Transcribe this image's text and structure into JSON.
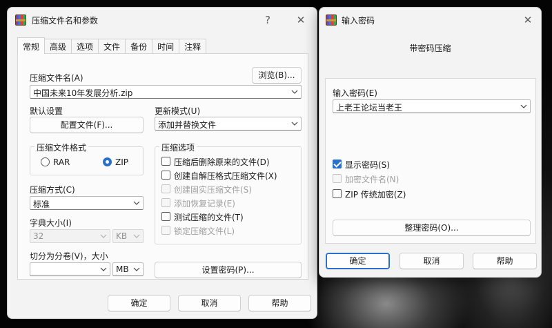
{
  "main_dialog": {
    "title": "压缩文件名和参数",
    "help_button": "?",
    "close_button": "✕",
    "tabs": [
      "常规",
      "高级",
      "选项",
      "文件",
      "备份",
      "时间",
      "注释"
    ],
    "archive_name_label": "压缩文件名(A)",
    "browse_button": "浏览(B)...",
    "archive_name_value": "中国未来10年发展分析.zip",
    "default_settings_label": "默认设置",
    "profiles_button": "配置文件(F)...",
    "update_mode_label": "更新模式(U)",
    "update_mode_value": "添加并替换文件",
    "format_group_label": "压缩文件格式",
    "format_rar": "RAR",
    "format_zip": "ZIP",
    "compression_method_label": "压缩方式(C)",
    "compression_method_value": "标准",
    "dictionary_size_label": "字典大小(I)",
    "dictionary_size_value": "32",
    "dictionary_unit": "KB",
    "split_label": "切分为分卷(V)，大小",
    "split_value": "",
    "split_unit": "MB",
    "options_group_label": "压缩选项",
    "options": [
      {
        "label": "压缩后删除原来的文件(D)",
        "checked": false,
        "enabled": true
      },
      {
        "label": "创建自解压格式压缩文件(X)",
        "checked": false,
        "enabled": true
      },
      {
        "label": "创建固实压缩文件(S)",
        "checked": false,
        "enabled": false
      },
      {
        "label": "添加恢复记录(E)",
        "checked": false,
        "enabled": false
      },
      {
        "label": "测试压缩的文件(T)",
        "checked": false,
        "enabled": true
      },
      {
        "label": "锁定压缩文件(L)",
        "checked": false,
        "enabled": false
      }
    ],
    "set_password_button": "设置密码(P)...",
    "ok_button": "确定",
    "cancel_button": "取消",
    "help_bottom_button": "帮助"
  },
  "password_dialog": {
    "title": "输入密码",
    "close_button": "✕",
    "header_text": "带密码压缩",
    "password_label": "输入密码(E)",
    "password_value": "上老王论坛当老王",
    "show_password": {
      "label": "显示密码(S)",
      "checked": true,
      "enabled": true
    },
    "encrypt_names": {
      "label": "加密文件名(N)",
      "checked": false,
      "enabled": false
    },
    "zip_legacy": {
      "label": "ZIP 传统加密(Z)",
      "checked": false,
      "enabled": true
    },
    "organize_button": "整理密码(O)...",
    "ok_button": "确定",
    "cancel_button": "取消",
    "help_button": "帮助"
  },
  "colors": {
    "accent": "#2a6fc9",
    "window_bg": "#f3f3f3",
    "panel_bg": "#fbfbfb",
    "disabled_text": "#9c9c9c"
  }
}
